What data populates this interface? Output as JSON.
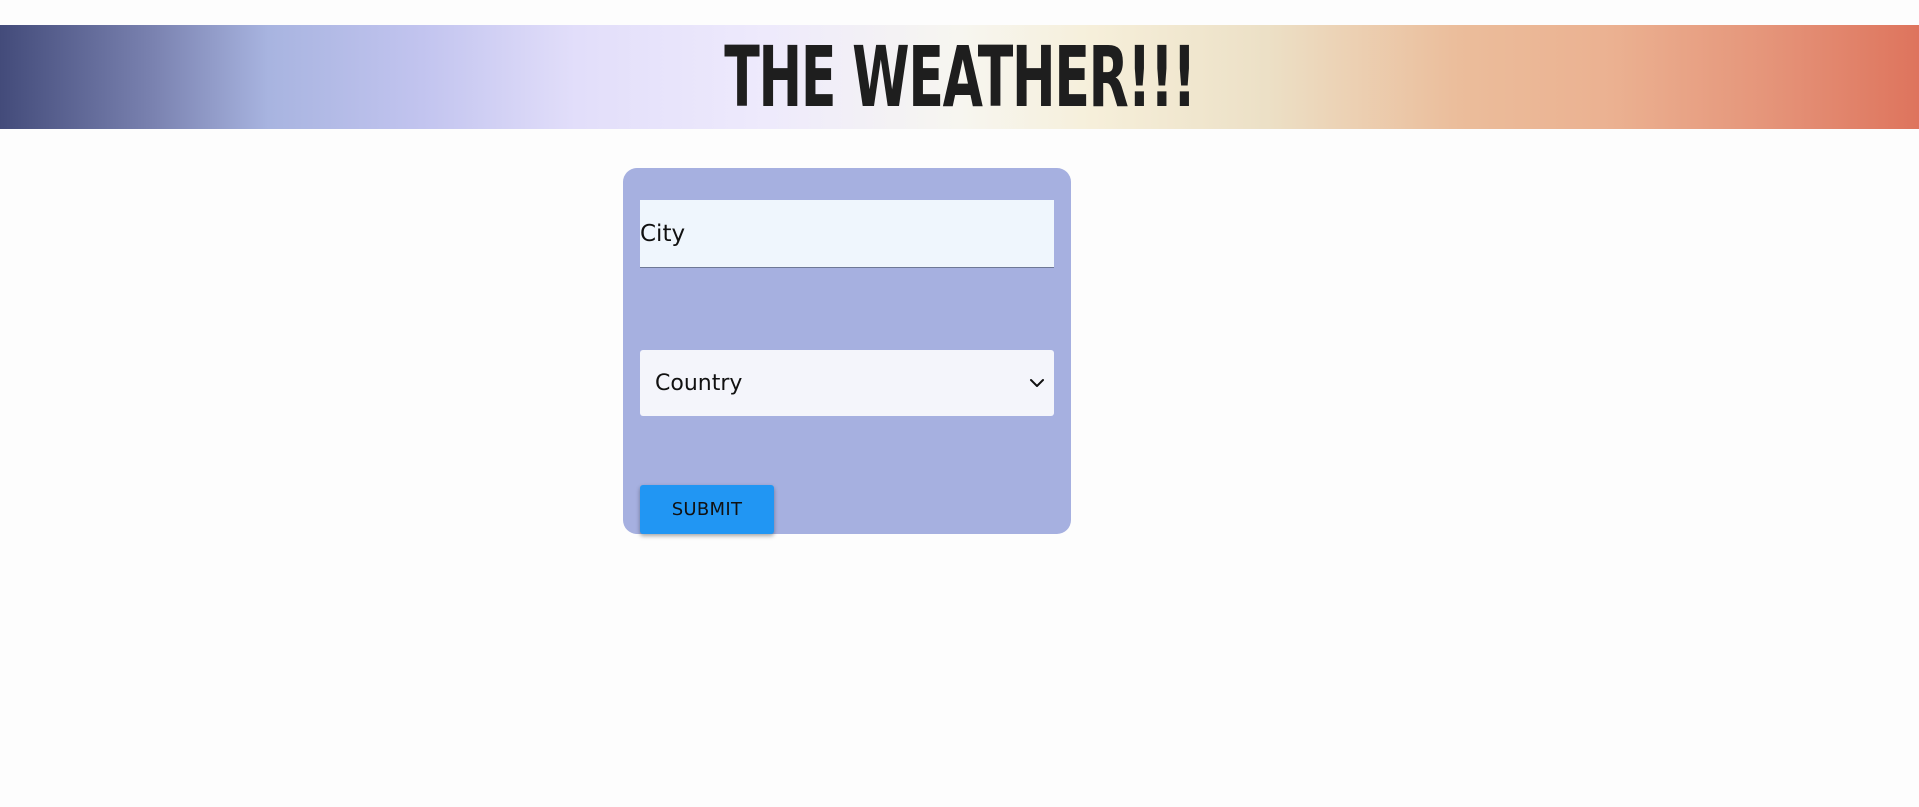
{
  "header": {
    "title": "THE WEATHER!!!"
  },
  "form": {
    "city": {
      "placeholder": "City",
      "value": ""
    },
    "country": {
      "selected": "Country"
    },
    "submit_label": "SUBMIT"
  },
  "colors": {
    "card_background": "#a6b0e0",
    "submit_button": "#2196f3",
    "input_background": "#eff6fd",
    "gradient_start": "#434b7a",
    "gradient_end": "#de745d"
  },
  "icons": {
    "country_dropdown": "chevron-down-icon"
  }
}
